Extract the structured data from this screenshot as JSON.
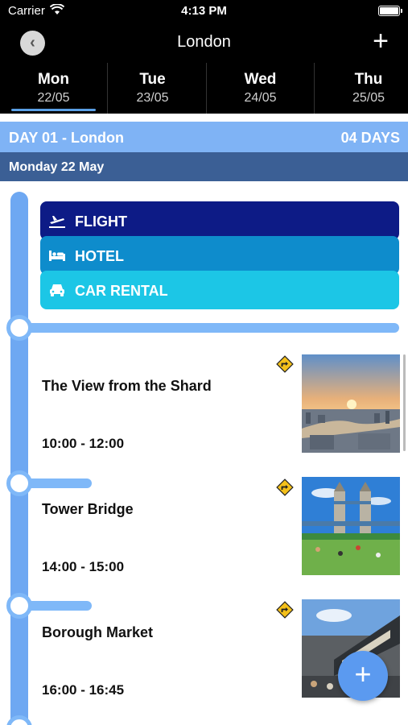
{
  "status": {
    "carrier": "Carrier",
    "time": "4:13 PM"
  },
  "nav": {
    "title": "London",
    "back_icon": "chevron-left-icon",
    "add_icon": "plus-icon"
  },
  "days": [
    {
      "dow": "Mon",
      "date": "22/05",
      "selected": true
    },
    {
      "dow": "Tue",
      "date": "23/05",
      "selected": false
    },
    {
      "dow": "Wed",
      "date": "24/05",
      "selected": false
    },
    {
      "dow": "Thu",
      "date": "25/05",
      "selected": false
    }
  ],
  "day_header": {
    "title": "DAY 01 - London",
    "duration": "04 DAYS"
  },
  "date_header": "Monday 22 May",
  "transport": [
    {
      "label": "FLIGHT",
      "icon": "airplane-icon",
      "color": "#0d1b86"
    },
    {
      "label": "HOTEL",
      "icon": "bed-icon",
      "color": "#0e8ccc"
    },
    {
      "label": "CAR RENTAL",
      "icon": "car-icon",
      "color": "#1cc6e6"
    }
  ],
  "activities": [
    {
      "title": "The View from the Shard",
      "time": "10:00 - 12:00",
      "icon": "directions-icon"
    },
    {
      "title": "Tower Bridge",
      "time": "14:00 - 15:00",
      "icon": "directions-icon"
    },
    {
      "title": "Borough Market",
      "time": "16:00 - 16:45",
      "icon": "directions-icon"
    }
  ],
  "colors": {
    "accent": "#5b9af0",
    "timeline": "#6ea8f2",
    "day_header": "#7fb3f5",
    "date_header": "#3b5f95"
  }
}
